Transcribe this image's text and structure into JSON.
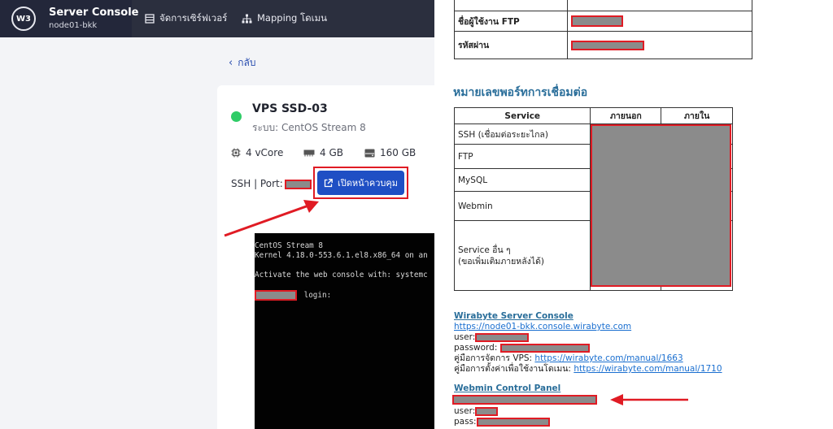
{
  "app": {
    "logo_text": "W3",
    "title": "Server Console",
    "subtitle": "node01-bkk",
    "nav": [
      {
        "label": "จัดการเซิร์ฟเวอร์",
        "icon": "server-list-icon"
      },
      {
        "label": "Mapping โดเมน",
        "icon": "sitemap-icon"
      }
    ],
    "back_label": "กลับ"
  },
  "vps": {
    "name": "VPS SSD-03",
    "os": "ระบบ: CentOS Stream 8",
    "specs": [
      {
        "label": "4 vCore",
        "icon": "cpu-icon"
      },
      {
        "label": "4 GB",
        "icon": "ram-icon"
      },
      {
        "label": "160 GB",
        "icon": "disk-icon"
      }
    ],
    "ssh_label": "SSH | Port:",
    "console_button": "เปิดหน้าควบคุม",
    "status_color": "#2fcc67"
  },
  "terminal": {
    "lines": [
      "CentOS Stream 8",
      "Kernel 4.18.0-553.6.1.el8.x86_64 on an",
      "",
      "Activate the web console with: systemc",
      ""
    ],
    "login_suffix": "login:"
  },
  "doc": {
    "table1": [
      {
        "label": "ชื่อผู้ใช้งาน FTP"
      },
      {
        "label": "รหัสผ่าน"
      }
    ],
    "ports_title": "หมายเลขพอร์ทการเชื่อมต่อ",
    "ports_headers": [
      "Service",
      "ภายนอก",
      "ภายใน"
    ],
    "ports_rows": [
      "SSH (เชื่อมต่อระยะไกล)",
      "FTP",
      "MySQL",
      "Webmin",
      "Service อื่น ๆ"
    ],
    "ports_note": "(ขอเพิ่มเติมภายหลังได้)",
    "wsc_title": "Wirabyte Server Console",
    "wsc_url": "https://node01-bkk.console.wirabyte.com",
    "user_label": "user:",
    "password_label": "password:",
    "manual_vps_label": "คู่มือการจัดการ VPS:",
    "manual_vps_url": "https://wirabyte.com/manual/1663",
    "manual_domain_label": "คู่มือการตั้งค่าเพื่อใช้งานโดเมน:",
    "manual_domain_url": "https://wirabyte.com/manual/1710",
    "webmin_title": "Webmin Control Panel",
    "webmin_user_label": "user:",
    "webmin_pass_label": "pass:"
  },
  "colors": {
    "highlight": "#e01b24",
    "topbar": "#2b2f3e",
    "primary_button": "#1f4fc4"
  }
}
